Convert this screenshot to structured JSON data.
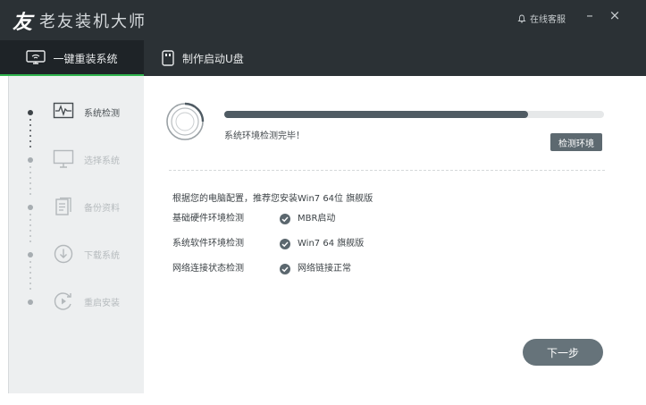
{
  "app": {
    "logo_glyph": "友",
    "title": "老友装机大师",
    "service_label": "在线客服",
    "minimize_label": "–",
    "close_label": "×"
  },
  "tabs": [
    {
      "label": "一键重装系统",
      "icon": "monitor-icon",
      "active": true
    },
    {
      "label": "制作启动U盘",
      "icon": "usb-icon",
      "active": false
    }
  ],
  "steps": [
    {
      "label": "系统检测",
      "icon": "pulse-monitor-icon",
      "active": true
    },
    {
      "label": "选择系统",
      "icon": "monitor-icon",
      "active": false
    },
    {
      "label": "备份资料",
      "icon": "document-icon",
      "active": false
    },
    {
      "label": "下载系统",
      "icon": "download-icon",
      "active": false
    },
    {
      "label": "重启安装",
      "icon": "restart-icon",
      "active": false
    }
  ],
  "main": {
    "progress": 0.8,
    "status_text": "系统环境检测完毕！",
    "check_button": "检测环境",
    "recommendation": "根据您的电脑配置，推荐您安装Win7 64位 旗舰版",
    "checks": [
      {
        "label": "基础硬件环境检测",
        "value": "MBR启动"
      },
      {
        "label": "系统软件环境检测",
        "value": "Win7 64 旗舰版"
      },
      {
        "label": "网络连接状态检测",
        "value": "网络链接正常"
      }
    ],
    "next_button": "下一步"
  },
  "colors": {
    "titlebar": "#2b3135",
    "tab_active_bg": "#1e2327",
    "accent_green": "#2fb34d",
    "progress_fill": "#4f5b63",
    "button_bg": "#5d6970",
    "check_icon": "#5b676e"
  }
}
